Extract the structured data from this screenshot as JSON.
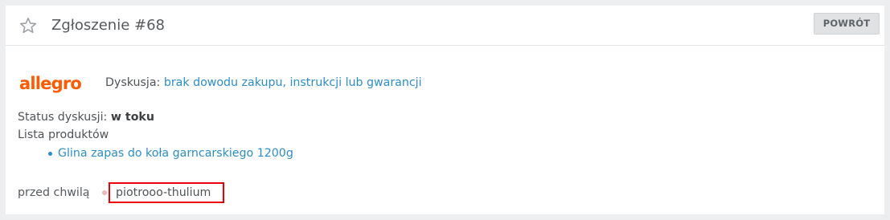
{
  "header": {
    "ticket_title": "Zgłoszenie #68",
    "back_label": "POWRÓT"
  },
  "marketplace": {
    "logo_text": "allegro",
    "brand_color": "#ff5a00"
  },
  "discussion": {
    "label": "Dyskusja:",
    "topic": "brak dowodu zakupu, instrukcji lub gwarancji"
  },
  "status": {
    "label": "Status dyskusji:",
    "value": "w toku"
  },
  "products": {
    "label": "Lista produktów",
    "items": [
      {
        "name": "Glina zapas do koła garncarskiego 1200g"
      }
    ]
  },
  "footer": {
    "time": "przed chwilą",
    "author": "piotrooo-thulium"
  },
  "colors": {
    "link": "#2d8ec7",
    "highlight_border": "#e8000d"
  }
}
